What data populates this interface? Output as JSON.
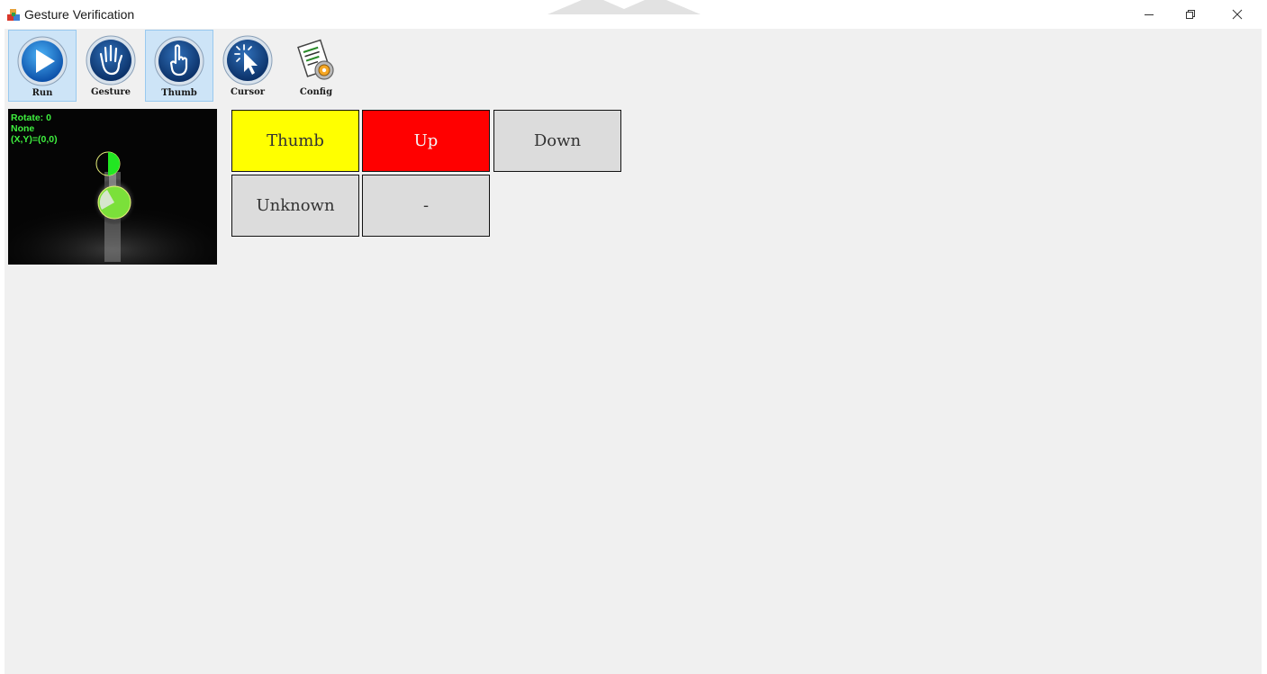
{
  "window": {
    "title": "Gesture Verification"
  },
  "toolbar": {
    "items": [
      {
        "label": "Run",
        "icon": "play-icon",
        "active": true
      },
      {
        "label": "Gesture",
        "icon": "hand-icon",
        "active": false
      },
      {
        "label": "Thumb",
        "icon": "pointing-finger-icon",
        "active": true
      },
      {
        "label": "Cursor",
        "icon": "cursor-click-icon",
        "active": false
      },
      {
        "label": "Config",
        "icon": "document-gear-icon",
        "active": false
      }
    ]
  },
  "preview": {
    "lines": [
      "Rotate: 0",
      "None",
      "(X,Y)=(0,0)"
    ],
    "overlay_color": "#3ff03f"
  },
  "results": {
    "cells": [
      {
        "label": "Thumb",
        "color": "#ffff00"
      },
      {
        "label": "Up",
        "color": "#ff0000"
      },
      {
        "label": "Down",
        "color": "#dcdcdc"
      },
      {
        "label": "Unknown",
        "color": "#dcdcdc"
      },
      {
        "label": "-",
        "color": "#dcdcdc"
      }
    ]
  }
}
